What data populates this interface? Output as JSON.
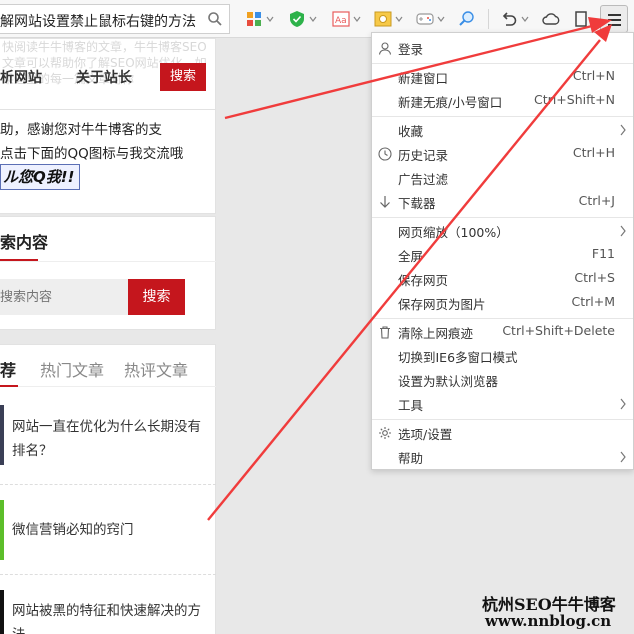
{
  "toolbar": {
    "address_text": "解网站设置禁止鼠标右键的方法",
    "icons": [
      "search-icon",
      "grid-apps-icon",
      "shield-icon",
      "translate-icon",
      "screenshot-icon",
      "gamepad-icon",
      "magnifier-icon",
      "undo-icon",
      "cloud-icon",
      "bookmark-icon",
      "menu-icon"
    ]
  },
  "page": {
    "faded_text": "快阅读牛牛博客的文章，牛牛博客SEO文章可以帮助你了解SEO网站优化，如果这里的每一篇文章对你",
    "nav": {
      "analyze": "析网站",
      "about": "关于站长",
      "search": "搜索"
    },
    "thanks": {
      "line1": "助，感谢您对牛牛博客的支",
      "line2": "点击下面的QQ图标与我交流哦",
      "qq_button": "ル您Q我!!"
    },
    "search": {
      "title": "索内容",
      "placeholder": "搜索内容",
      "button": "搜索"
    },
    "tabs": [
      "荐",
      "热门文章",
      "热评文章"
    ],
    "articles": [
      {
        "title": "网站一直在优化为什么长期没有排名？"
      },
      {
        "title": "微信营销必知的窍门"
      },
      {
        "title": "网站被黑的特征和快速解决的方法"
      }
    ]
  },
  "menu": {
    "items": [
      {
        "label": "登录",
        "shortcut": "",
        "icon": "user-icon"
      },
      {
        "label": "新建窗口",
        "shortcut": "Ctrl+N"
      },
      {
        "label": "新建无痕/小号窗口",
        "shortcut": "Ctrl+Shift+N"
      },
      {
        "label": "收藏",
        "shortcut": "",
        "submenu": true
      },
      {
        "label": "历史记录",
        "shortcut": "Ctrl+H",
        "icon": "clock-icon"
      },
      {
        "label": "广告过滤",
        "shortcut": ""
      },
      {
        "label": "下载器",
        "shortcut": "Ctrl+J",
        "icon": "download-arrow-icon"
      },
      {
        "label": "网页缩放（100%）",
        "shortcut": "",
        "submenu": true
      },
      {
        "label": "全屏",
        "shortcut": "F11"
      },
      {
        "label": "保存网页",
        "shortcut": "Ctrl+S"
      },
      {
        "label": "保存网页为图片",
        "shortcut": "Ctrl+M"
      },
      {
        "label": "清除上网痕迹",
        "shortcut": "Ctrl+Shift+Delete",
        "icon": "trash-icon"
      },
      {
        "label": "切换到IE6多窗口模式",
        "shortcut": ""
      },
      {
        "label": "设置为默认浏览器",
        "shortcut": ""
      },
      {
        "label": "工具",
        "shortcut": "",
        "submenu": true
      },
      {
        "label": "选项/设置",
        "shortcut": "",
        "icon": "gear-icon"
      },
      {
        "label": "帮助",
        "shortcut": "",
        "submenu": true
      }
    ]
  },
  "watermark": {
    "name": "杭州SEO牛牛博客",
    "url": "www.nnblog.cn"
  },
  "colors": {
    "accent_red": "#c5161d",
    "arrow_red": "#f03c3c"
  }
}
